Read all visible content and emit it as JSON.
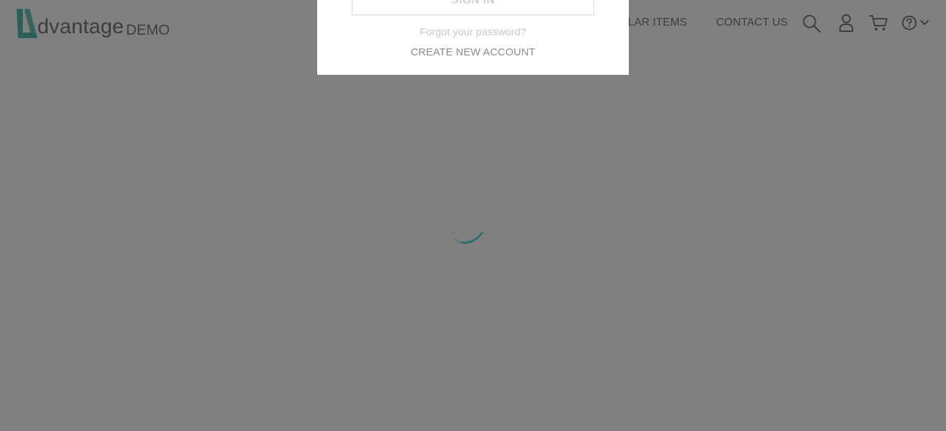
{
  "header": {
    "logo_word": "dvantage",
    "logo_demo": "DEMO",
    "nav": {
      "popular_items": "ULAR ITEMS",
      "contact_us": "CONTACT US"
    },
    "icons": [
      "search-icon",
      "user-icon",
      "cart-icon",
      "help-icon",
      "chevron-down-icon"
    ]
  },
  "login_popup": {
    "sign_in_label": "SIGN IN",
    "forgot_password": "Forgot your password?",
    "create_account": "CREATE NEW ACCOUNT"
  },
  "colors": {
    "overlay": "#808080",
    "brand": "#2b5f5a",
    "loader": "#1f6f6b",
    "popup_bg": "#ffffff"
  }
}
